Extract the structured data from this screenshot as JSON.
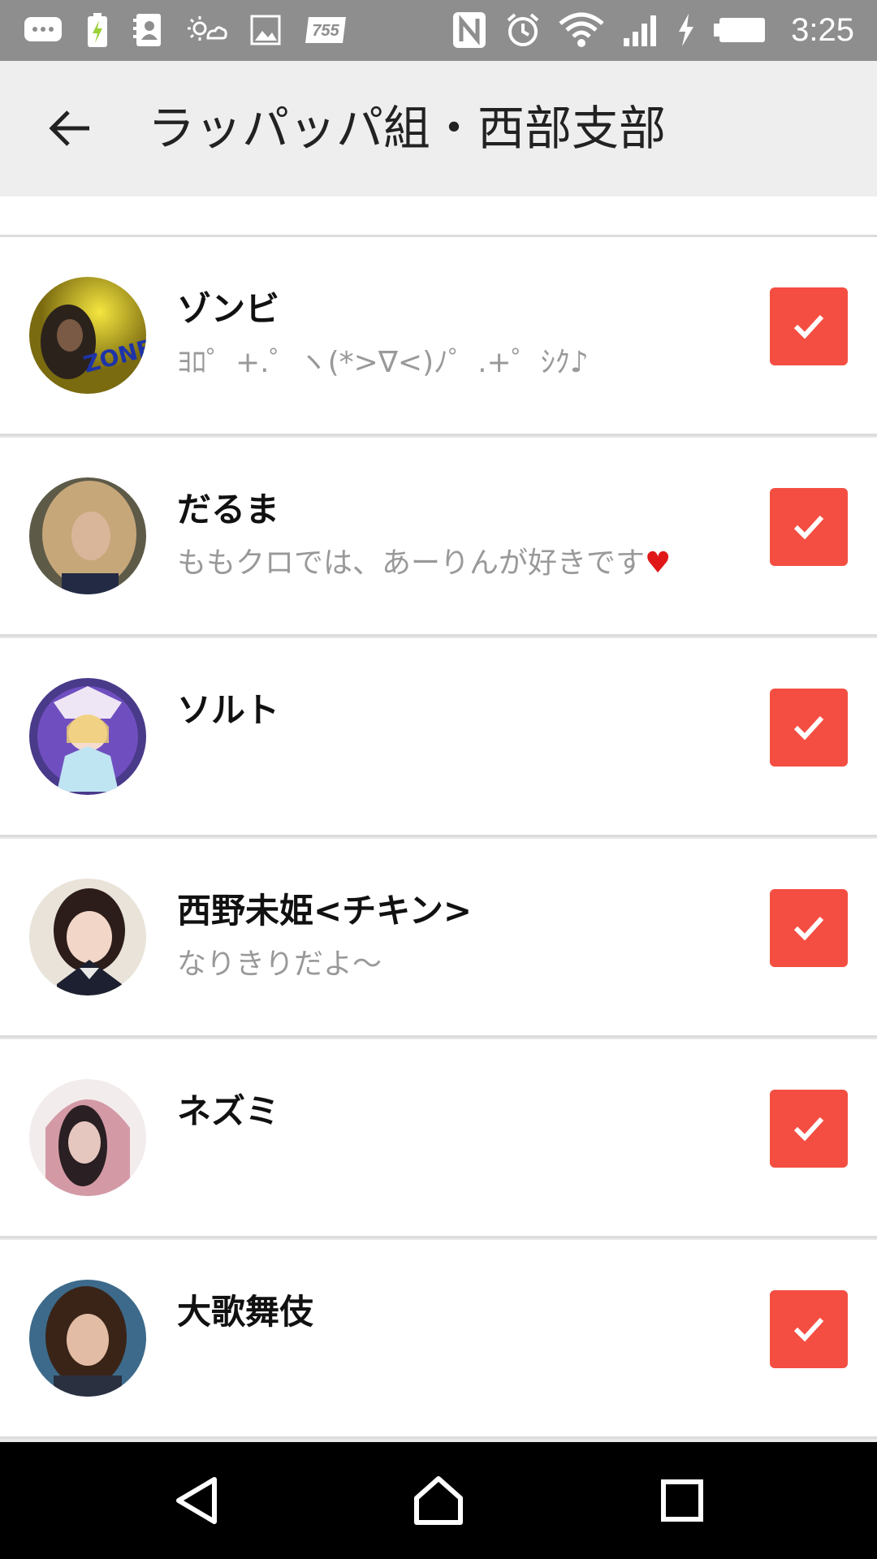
{
  "status_bar": {
    "time": "3:25",
    "left_icons": [
      "message-icon",
      "battery-saver-icon",
      "contacts-icon",
      "weather-icon",
      "image-icon",
      "app-badge-icon"
    ],
    "app_badge_text": "755",
    "right_icons": [
      "nfc-icon",
      "alarm-icon",
      "wifi-icon",
      "signal-icon",
      "charging-icon",
      "battery-icon"
    ]
  },
  "app_bar": {
    "title": "ラッパッパ組・西部支部",
    "back_icon": "arrow-left-icon"
  },
  "members": [
    {
      "name": "ゾンビ",
      "status": "ﾖﾛ゜+.゜ヽ(*>∇<)ﾉ゜.+゜ｼｸ♪",
      "checked": true,
      "avatar_color": "#c9b21a"
    },
    {
      "name": "だるま",
      "status": "ももクロでは、あーりんが好きです",
      "status_suffix": "♥",
      "checked": true,
      "avatar_color": "#9a7a4a"
    },
    {
      "name": "ソルト",
      "status": "",
      "checked": true,
      "avatar_color": "#6a4fb0"
    },
    {
      "name": "西野未姫<チキン>",
      "status": "なりきりだよ〜",
      "checked": true,
      "avatar_color": "#d9c7b8"
    },
    {
      "name": "ネズミ",
      "status": "",
      "checked": true,
      "avatar_color": "#c98a9a"
    },
    {
      "name": "大歌舞伎",
      "status": "",
      "checked": true,
      "avatar_color": "#4a6f8f"
    }
  ],
  "colors": {
    "accent": "#f44e42",
    "status_bar": "#8e8e8e",
    "app_bar": "#eeeeee",
    "nav_bar": "#000000"
  },
  "nav_bar": {
    "icons": [
      "back-triangle-icon",
      "home-icon",
      "recents-icon"
    ]
  }
}
